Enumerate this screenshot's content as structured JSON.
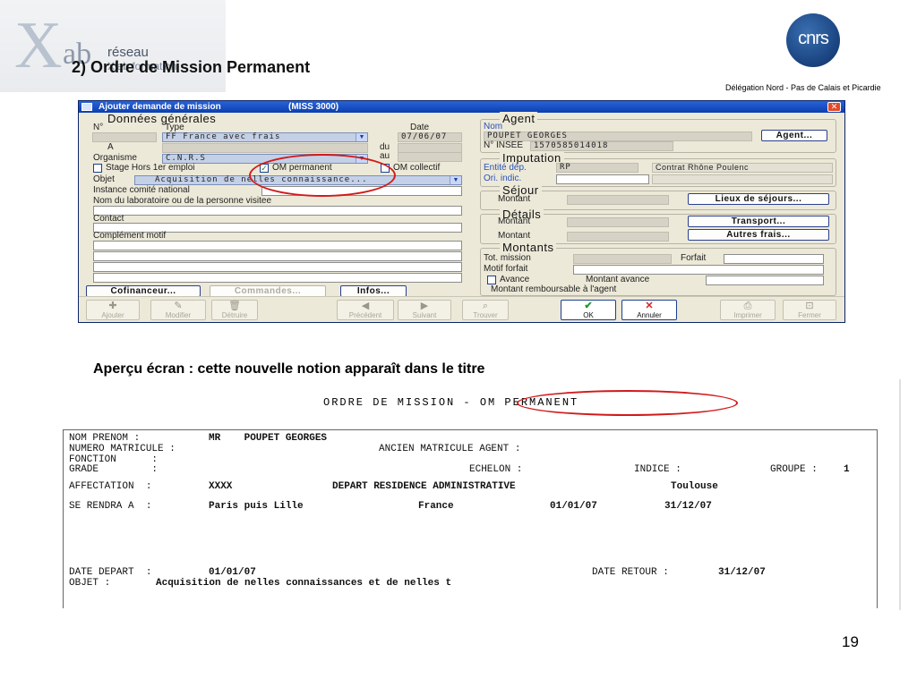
{
  "slide": {
    "logo_reseau": "réseau",
    "logo_sub": "Xlab formation",
    "title": "2) Ordre de Mission Permanent",
    "org_logo": "cnrs",
    "delegation": "Délégation Nord - Pas de Calais et Picardie",
    "caption": "Aperçu écran : cette nouvelle notion apparaît dans le titre",
    "page_number": "19"
  },
  "window": {
    "title": "Ajouter demande de mission",
    "code": "(MISS 3000)",
    "general": {
      "heading": "Données générales",
      "no_label": "N°",
      "type_label": "Type",
      "date_label": "Date",
      "type_value": "FF France avec frais",
      "date_value": "07/06/07",
      "a_label": "A",
      "du_label": "du",
      "au_label": "au",
      "organisme_label": "Organisme",
      "organisme_value": "C.N.R.S",
      "stage_label": "Stage Hors 1er emploi",
      "om_permanent_label": "OM permanent",
      "om_permanent_checked": true,
      "om_collectif_label": "OM collectif",
      "objet_label": "Objet",
      "objet_value": "Acquisition de nelles connaissance...",
      "instance_label": "Instance comité national",
      "labo_label": "Nom du laboratoire ou de la personne visitee",
      "contact_label": "Contact",
      "complement_label": "Complément motif"
    },
    "agent": {
      "heading": "Agent",
      "nom_label": "Nom",
      "nom_value": "POUPET GEORGES",
      "agent_button": "Agent...",
      "insee_label": "N° INSEE",
      "insee_value": "1570585014018"
    },
    "imputation": {
      "heading": "Imputation",
      "entite_label": "Entité dép.",
      "entite_value": "RP",
      "contrat_value": "Contrat Rhône Poulenc",
      "ori_label": "Ori. indic."
    },
    "sejour": {
      "heading": "Séjour",
      "montant_label": "Montant",
      "lieux_button": "Lieux de séjours..."
    },
    "details": {
      "heading": "Détails",
      "montant1_label": "Montant",
      "montant2_label": "Montant",
      "transport_button": "Transport...",
      "autres_button": "Autres frais..."
    },
    "montants": {
      "heading": "Montants",
      "tot_label": "Tot. mission",
      "forfait_label": "Forfait",
      "motif_label": "Motif forfait",
      "avance_label": "Avance",
      "montant_avance_label": "Montant avance",
      "rembourse_label": "Montant remboursable à l'agent"
    },
    "bottom_buttons": {
      "cofinanceur": "Cofinanceur...",
      "commandes": "Commandes...",
      "infos": "Infos..."
    },
    "toolbar": [
      {
        "label": "Ajouter",
        "icon": "add-icon",
        "enabled": false
      },
      {
        "label": "Modifier",
        "icon": "edit-icon",
        "enabled": false
      },
      {
        "label": "Détruire",
        "icon": "delete-icon",
        "enabled": false
      },
      {
        "label": "Précédent",
        "icon": "previous-icon",
        "enabled": false
      },
      {
        "label": "Suivant",
        "icon": "next-icon",
        "enabled": false
      },
      {
        "label": "Trouver",
        "icon": "find-icon",
        "enabled": false
      },
      {
        "label": "OK",
        "icon": "check-icon",
        "enabled": true
      },
      {
        "label": "Annuler",
        "icon": "cancel-icon",
        "enabled": true
      },
      {
        "label": "Imprimer",
        "icon": "print-icon",
        "enabled": false
      },
      {
        "label": "Fermer",
        "icon": "close-door-icon",
        "enabled": false
      }
    ]
  },
  "report": {
    "title": "ORDRE DE MISSION - OM PERMANENT",
    "nom_label": "NOM PRENOM :",
    "nom_value": "MR    POUPET GEORGES",
    "matricule_label": "NUMERO MATRICULE :",
    "ancien_label": "ANCIEN MATRICULE AGENT :",
    "fonction_label": "FONCTION      :",
    "grade_label": "GRADE         :",
    "echelon_label": "ECHELON :",
    "indice_label": "INDICE :",
    "groupe_label": "GROUPE :",
    "groupe_value": "1",
    "affectation_label": "AFFECTATION  :",
    "affectation_value": "XXXX",
    "depart_res_label": "DEPART RESIDENCE ADMINISTRATIVE",
    "depart_res_value": "Toulouse",
    "se_rendra_label": "SE RENDRA A  :",
    "se_rendra_value": "Paris puis Lille",
    "pays_value": "France",
    "date_debut": "01/01/07",
    "date_fin": "31/12/07",
    "date_depart_label": "DATE DEPART  :",
    "date_depart_value": "01/01/07",
    "date_retour_label": "DATE RETOUR :",
    "date_retour_value": "31/12/07",
    "objet_label": "OBJET :",
    "objet_value": "Acquisition de nelles connaissances et de nelles t"
  }
}
